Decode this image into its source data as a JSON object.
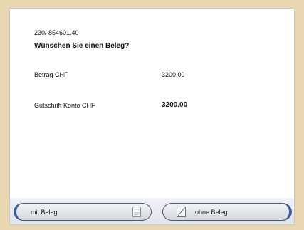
{
  "transaction": {
    "reference": "230/ 854601.40",
    "question": "Wünschen Sie einen Beleg?"
  },
  "amounts": {
    "betrag_label": "Betrag  CHF",
    "betrag_value": "3200.00",
    "gutschrift_label": "Gutschrift Konto  CHF",
    "gutschrift_value": "3200.00"
  },
  "buttons": {
    "with_receipt_label": "mit Beleg",
    "without_receipt_label": "ohne Beleg"
  },
  "colors": {
    "background": "#e9d7b1",
    "screen": "#ffffff",
    "button_border": "#4e5a72",
    "button_accent": "#3d5a98"
  },
  "icons": {
    "with_receipt": "receipt-document-icon",
    "without_receipt": "no-receipt-icon"
  }
}
